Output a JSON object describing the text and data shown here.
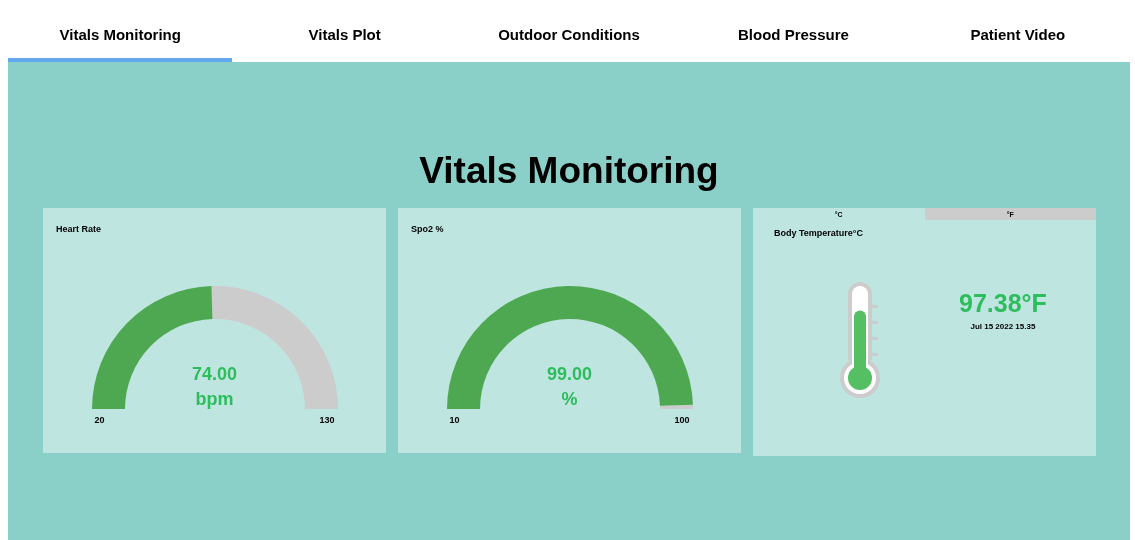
{
  "tabs": [
    {
      "label": "Vitals Monitoring",
      "selected": true
    },
    {
      "label": "Vitals Plot",
      "selected": false
    },
    {
      "label": "Outdoor Conditions",
      "selected": false
    },
    {
      "label": "Blood Pressure",
      "selected": false
    },
    {
      "label": "Patient Video",
      "selected": false
    }
  ],
  "heading": "Vitals Monitoring",
  "gauges": [
    {
      "title": "Heart Rate",
      "value": "74.00",
      "unit": "bpm",
      "min": "20",
      "max": "130"
    },
    {
      "title": "Spo2 %",
      "value": "99.00",
      "unit": "%",
      "min": "10",
      "max": "100"
    }
  ],
  "temperature": {
    "unit_tabs": [
      {
        "label": "°C",
        "selected": true
      },
      {
        "label": "°F",
        "selected": false
      }
    ],
    "title": "Body Temperature°C",
    "level": 0.88,
    "reading": "97.38°F",
    "timestamp": "Jul 15 2022 15.35"
  }
}
